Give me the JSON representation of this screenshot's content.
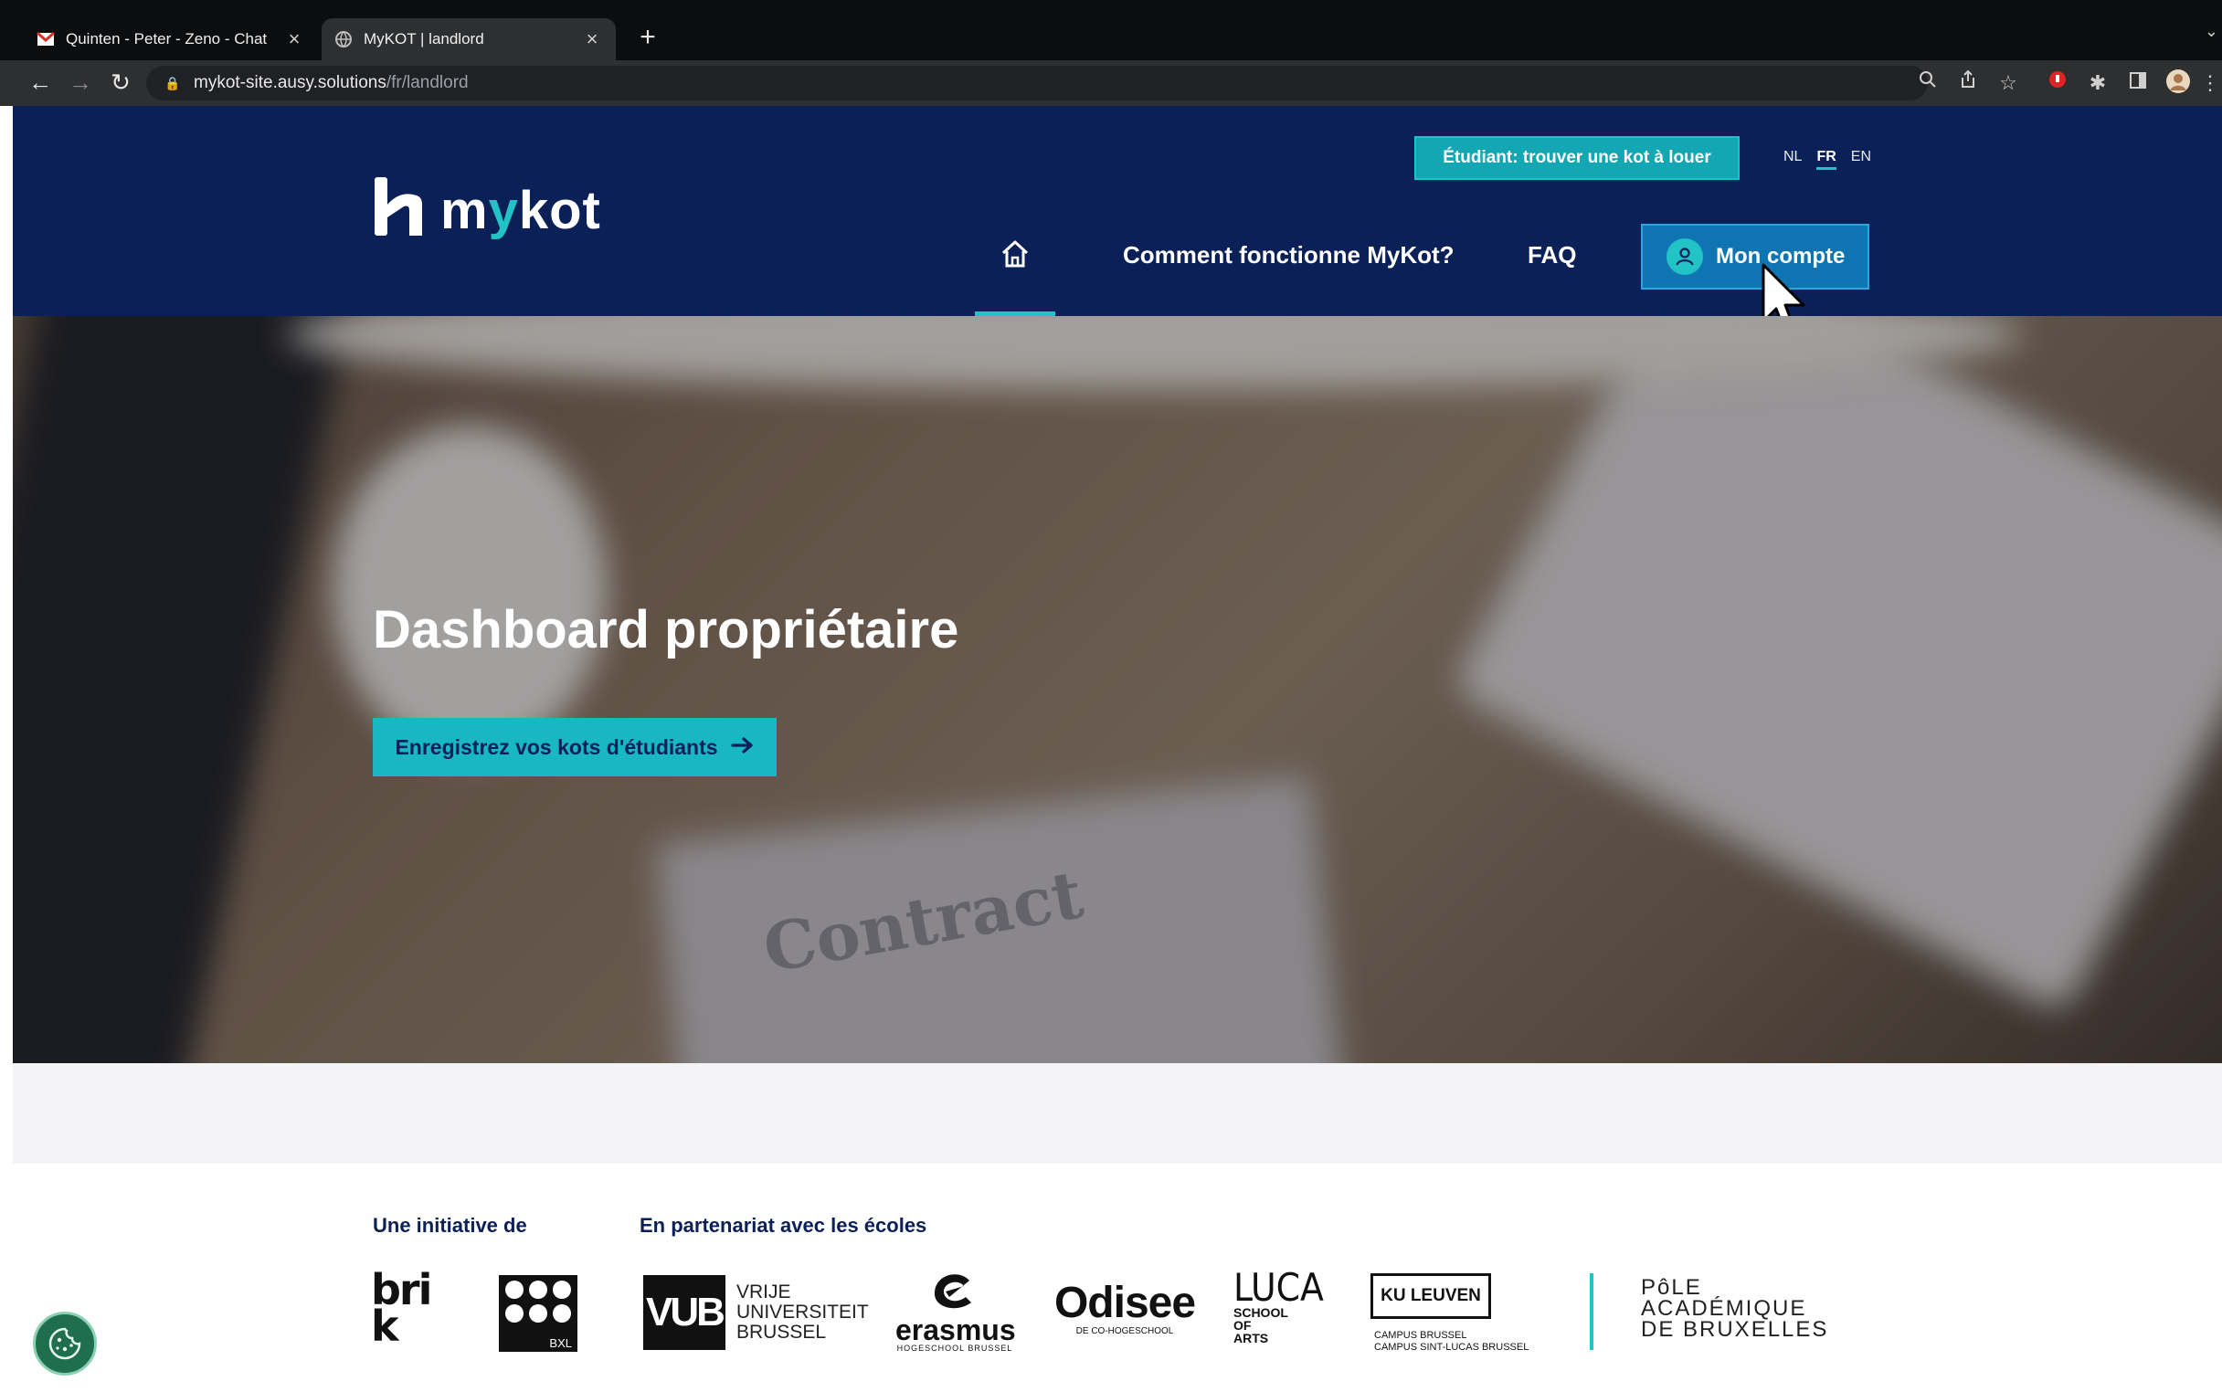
{
  "browser": {
    "tabs": [
      {
        "title": "Quinten - Peter - Zeno - Chat",
        "active": false
      },
      {
        "title": "MyKOT | landlord",
        "active": true
      }
    ],
    "url_host": "mykot-site.ausy.solutions",
    "url_path": "/fr/landlord"
  },
  "header": {
    "logo_text_pre": "m",
    "logo_text_y": "y",
    "logo_text_post": "kot",
    "student_button": "Étudiant: trouver une kot à louer",
    "languages": [
      "NL",
      "FR",
      "EN"
    ],
    "active_language": "FR",
    "nav": {
      "how_it_works": "Comment fonctionne MyKot?",
      "faq": "FAQ",
      "account": "Mon compte"
    }
  },
  "hero": {
    "title": "Dashboard propriétaire",
    "cta": "Enregistrez vos kots d'étudiants",
    "background_text": "Contract"
  },
  "footer": {
    "initiative_label": "Une initiative de",
    "partners_label": "En partenariat avec les écoles",
    "initiative_logos": [
      "brik",
      "BXL"
    ],
    "partner_logos": {
      "vub_mark": "VUB",
      "vub_text": [
        "VRIJE",
        "UNIVERSITEIT",
        "BRUSSEL"
      ],
      "erasmus": "erasmus",
      "erasmus_sub": "HOGESCHOOL BRUSSEL",
      "odisee": "Odisee",
      "odisee_sub": "DE CO-HOGESCHOOL",
      "luca": "LUCA",
      "luca_sub": [
        "SCHOOL",
        "OF",
        "ARTS"
      ],
      "kul": "KU LEUVEN",
      "kul_sub": [
        "CAMPUS BRUSSEL",
        "CAMPUS SINT-LUCAS BRUSSEL"
      ],
      "pole": [
        "PôLE",
        "ACADÉMIQUE",
        "DE BRUXELLES"
      ]
    }
  },
  "colors": {
    "navy": "#0a2057",
    "teal": "#22c3c6",
    "account_blue": "#0f75b2"
  }
}
